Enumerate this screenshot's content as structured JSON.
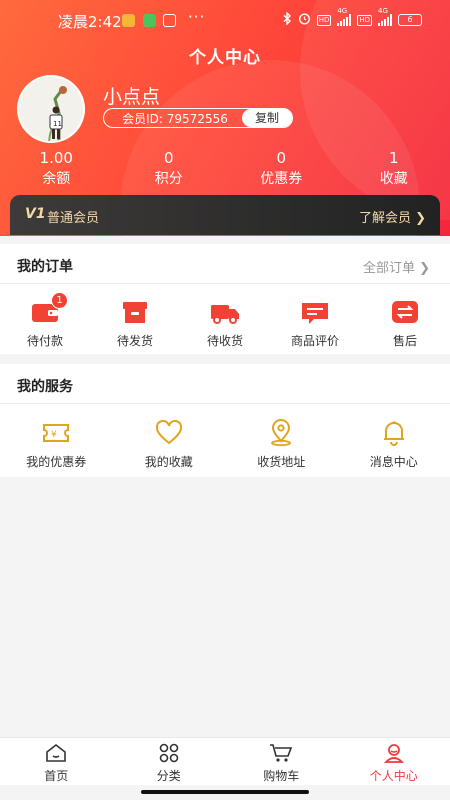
{
  "status_bar": {
    "time": "凌晨2:42",
    "dots": "···",
    "network_1": "4G",
    "network_2": "4G",
    "hd": "HD",
    "battery": "6"
  },
  "page_title": "个人中心",
  "profile": {
    "username": "小点点",
    "member_id_label": "会员ID: 79572556",
    "copy_label": "复制"
  },
  "stats": [
    {
      "value": "1.00",
      "label": "余额"
    },
    {
      "value": "0",
      "label": "积分"
    },
    {
      "value": "0",
      "label": "优惠券"
    },
    {
      "value": "1",
      "label": "收藏"
    }
  ],
  "vip": {
    "logo": "V1",
    "name": "普通会员",
    "more": "了解会员 ❯"
  },
  "orders": {
    "title": "我的订单",
    "all_label": "全部订单 ❯",
    "items": [
      {
        "label": "待付款",
        "icon": "wallet-icon",
        "badge": "1"
      },
      {
        "label": "待发货",
        "icon": "box-icon"
      },
      {
        "label": "待收货",
        "icon": "truck-icon"
      },
      {
        "label": "商品评价",
        "icon": "comment-icon"
      },
      {
        "label": "售后",
        "icon": "exchange-icon"
      }
    ]
  },
  "services": {
    "title": "我的服务",
    "items": [
      {
        "label": "我的优惠券",
        "icon": "coupon-icon"
      },
      {
        "label": "我的收藏",
        "icon": "heart-icon"
      },
      {
        "label": "收货地址",
        "icon": "location-icon"
      },
      {
        "label": "消息中心",
        "icon": "bell-icon"
      }
    ]
  },
  "tabbar": [
    {
      "label": "首页",
      "icon": "home-icon"
    },
    {
      "label": "分类",
      "icon": "category-icon"
    },
    {
      "label": "购物车",
      "icon": "cart-icon"
    },
    {
      "label": "个人中心",
      "icon": "user-icon",
      "active": true
    }
  ],
  "colors": {
    "primary": "#f5263a",
    "gold": "#e0a421",
    "vip_text": "#f3d9a8"
  }
}
